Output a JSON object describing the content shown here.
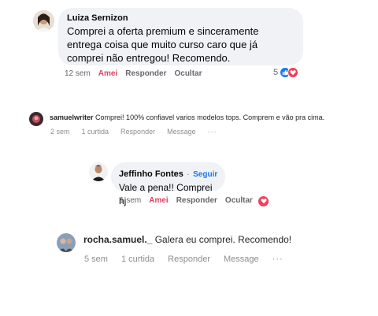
{
  "comment1": {
    "author": "Luiza Sernizon",
    "text": "Comprei a oferta premium e sinceramente entrega coisa que muito curso caro que já comprei não entregou! Recomendo.",
    "time": "12 sem",
    "like": "Amei",
    "reply": "Responder",
    "hide": "Ocultar",
    "reaction_count": "5",
    "reactions": [
      "like-icon",
      "love-icon"
    ]
  },
  "comment2": {
    "author": "samuelwriter",
    "text": "Comprei! 100% confiavel varios modelos tops. Comprem e vão pra cima.",
    "time": "2 sem",
    "likes": "1 curtida",
    "reply": "Responder",
    "message": "Message",
    "more": "···"
  },
  "comment3": {
    "author": "Jeffinho Fontes",
    "separator": "·",
    "follow": "Seguir",
    "text": "Vale a pena!! Comprei hj",
    "time": "1 sem",
    "like": "Amei",
    "reply": "Responder",
    "hide": "Ocultar",
    "reactions": [
      "love-icon"
    ]
  },
  "comment4": {
    "author": "rocha.samuel._",
    "text": "Galera eu comprei. Recomendo!",
    "time": "5 sem",
    "likes": "1 curtida",
    "reply": "Responder",
    "message": "Message",
    "more": "···"
  },
  "colors": {
    "bubble": "#f0f2f5",
    "secondary_text": "#65676b",
    "love_red": "#e4405f",
    "like_blue": "#1877f2",
    "follow_blue": "#1877f2"
  }
}
